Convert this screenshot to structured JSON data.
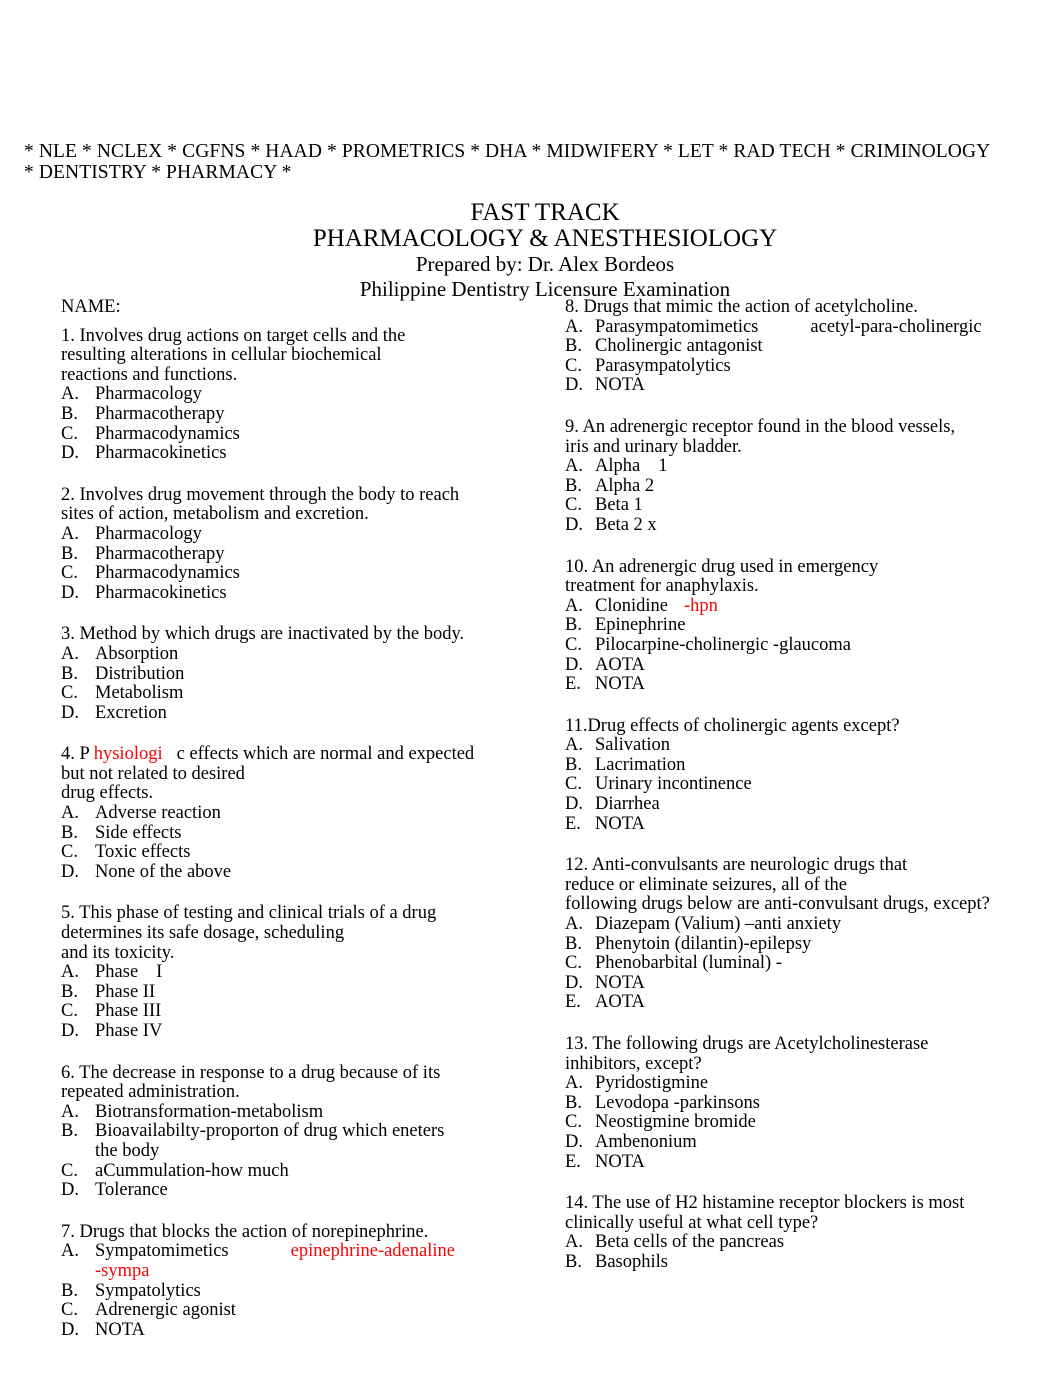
{
  "document": {
    "masthead": "* NLE * NCLEX * CGFNS * HAAD * PROMETRICS * DHA * MIDWIFERY * LET * RAD TECH * CRIMINOLOGY * DENTISTRY * PHARMACY *",
    "title_main": "FAST TRACK",
    "title_subject": "PHARMACOLOGY & ANESTHESIOLOGY",
    "prepared_by": "Prepared by: Dr. Alex Bordeos",
    "exam_name": "Philippine Dentistry Licensure Examination",
    "name_field_label": "NAME:",
    "accent_red": "#fa0505",
    "text_color": "#000000",
    "background": "#ffffff"
  },
  "left_column": {
    "questions": [
      {
        "number": "1.",
        "stem_lines": [
          "1. Involves drug actions on target cells and the",
          "resulting alterations in cellular biochemical",
          "reactions and functions."
        ],
        "options": [
          {
            "letter": "A.",
            "text": "Pharmacology"
          },
          {
            "letter": "B.",
            "text": "Pharmacotherapy"
          },
          {
            "letter": "C.",
            "text": "Pharmacodynamics"
          },
          {
            "letter": "D.",
            "text": "Pharmacokinetics"
          }
        ]
      },
      {
        "number": "2.",
        "stem_lines": [
          "2. Involves drug movement through the body to reach",
          "sites of action, metabolism and excretion."
        ],
        "options": [
          {
            "letter": "A.",
            "text": "Pharmacology"
          },
          {
            "letter": "B.",
            "text": "Pharmacotherapy"
          },
          {
            "letter": "C.",
            "text": "Pharmacodynamics"
          },
          {
            "letter": "D.",
            "text": "Pharmacokinetics"
          }
        ]
      },
      {
        "number": "3.",
        "stem_lines": [
          "3. Method by which drugs are inactivated by the body."
        ],
        "options": [
          {
            "letter": "A.",
            "text": "Absorption"
          },
          {
            "letter": "B.",
            "text": "Distribution"
          },
          {
            "letter": "C.",
            "text": "Metabolism"
          },
          {
            "letter": "D.",
            "text": "Excretion"
          }
        ]
      },
      {
        "number": "4.",
        "stem_part_1": "4. P",
        "stem_red": "hysiologi",
        "stem_part_2": "c effects which are normal and expected",
        "stem_lines_rest": [
          "but not related to desired",
          "drug effects."
        ],
        "options": [
          {
            "letter": "A.",
            "text": "Adverse reaction"
          },
          {
            "letter": "B.",
            "text": "Side effects"
          },
          {
            "letter": "C.",
            "text": "Toxic effects"
          },
          {
            "letter": "D.",
            "text": "None of the above"
          }
        ]
      },
      {
        "number": "5.",
        "stem_lines": [
          "5. This phase of testing and clinical trials of a drug",
          "determines its safe dosage, scheduling",
          "and its toxicity."
        ],
        "options": [
          {
            "letter": "A.",
            "text": "Phase",
            "extra": "I"
          },
          {
            "letter": "B.",
            "text": "Phase II"
          },
          {
            "letter": "C.",
            "text": "Phase III"
          },
          {
            "letter": "D.",
            "text": "Phase IV"
          }
        ]
      },
      {
        "number": "6.",
        "stem_lines": [
          "6. The decrease in response to a drug because of its",
          "repeated administration."
        ],
        "options": [
          {
            "letter": "A.",
            "text": "Biotransformation-metabolism"
          },
          {
            "letter": "B.",
            "text": "Bioavailabilty-proporton of drug which eneters",
            "text_line2": "the body"
          },
          {
            "letter": "C.",
            "text": "aCummulation-how much"
          },
          {
            "letter": "D.",
            "text": "Tolerance"
          }
        ]
      },
      {
        "number": "7.",
        "stem_lines": [
          "7. Drugs that blocks the action of norepinephrine."
        ],
        "options": [
          {
            "letter": "A.",
            "text": "Sympatomimetics",
            "annotation_red": "epinephrine-adenaline",
            "annotation_red_line2": "-sympa"
          },
          {
            "letter": "B.",
            "text": "Sympatolytics"
          },
          {
            "letter": "C.",
            "text": "Adrenergic agonist"
          },
          {
            "letter": "D.",
            "text": "NOTA"
          }
        ]
      }
    ]
  },
  "right_column": {
    "questions": [
      {
        "number": "8.",
        "stem_lines": [
          "8. Drugs that mimic the action of acetylcholine."
        ],
        "options": [
          {
            "letter": "A.",
            "text": "Parasympatomimetics",
            "annotation": "acetyl-para-cholinergic"
          },
          {
            "letter": "B.",
            "text": "Cholinergic antagonist"
          },
          {
            "letter": "C.",
            "text": "Parasympatolytics"
          },
          {
            "letter": "D.",
            "text": "NOTA"
          }
        ]
      },
      {
        "number": "9.",
        "stem_lines": [
          "9. An adrenergic receptor found in the blood vessels,",
          "iris and urinary bladder."
        ],
        "options": [
          {
            "letter": "A.",
            "text": "Alpha",
            "extra": "1"
          },
          {
            "letter": "B.",
            "text": "Alpha 2"
          },
          {
            "letter": "C.",
            "text": "Beta 1"
          },
          {
            "letter": "D.",
            "text": "Beta 2 x"
          }
        ]
      },
      {
        "number": "10.",
        "stem_lines": [
          "10. An adrenergic drug used in emergency",
          "treatment for anaphylaxis."
        ],
        "options": [
          {
            "letter": "A.",
            "text": "Clonidine",
            "annotation_red": "-hpn"
          },
          {
            "letter": "B.",
            "text": "Epinephrine"
          },
          {
            "letter": "C.",
            "text": "Pilocarpine-cholinergic -glaucoma"
          },
          {
            "letter": "D.",
            "text": "AOTA"
          },
          {
            "letter": "E.",
            "text": "NOTA"
          }
        ]
      },
      {
        "number": "11.",
        "stem_lines": [
          "11.Drug effects of cholinergic agents except?"
        ],
        "options": [
          {
            "letter": "A.",
            "text": "Salivation"
          },
          {
            "letter": "B.",
            "text": "Lacrimation"
          },
          {
            "letter": "C.",
            "text": "Urinary incontinence"
          },
          {
            "letter": "D.",
            "text": "Diarrhea"
          },
          {
            "letter": "E.",
            "text": "NOTA"
          }
        ]
      },
      {
        "number": "12.",
        "stem_lines": [
          "12. Anti-convulsants are neurologic drugs that",
          "reduce or eliminate seizures, all of the",
          "following drugs below are anti-convulsant drugs, except?"
        ],
        "options": [
          {
            "letter": "A.",
            "text": "Diazepam (Valium) –anti anxiety"
          },
          {
            "letter": "B.",
            "text": "Phenytoin (dilantin)-epilepsy"
          },
          {
            "letter": "C.",
            "text": "Phenobarbital (luminal) -"
          },
          {
            "letter": "D.",
            "text": "NOTA"
          },
          {
            "letter": "E.",
            "text": "AOTA"
          }
        ]
      },
      {
        "number": "13.",
        "stem_lines": [
          "13. The following drugs are Acetylcholinesterase",
          "inhibitors, except?"
        ],
        "options": [
          {
            "letter": "A.",
            "text": "Pyridostigmine"
          },
          {
            "letter": "B.",
            "text": "Levodopa -parkinsons"
          },
          {
            "letter": "C.",
            "text": "Neostigmine bromide"
          },
          {
            "letter": "D.",
            "text": "Ambenonium"
          },
          {
            "letter": "E.",
            "text": "NOTA"
          }
        ]
      },
      {
        "number": "14.",
        "stem_lines": [
          "14. The use of H2 histamine receptor blockers is most",
          "clinically useful at what cell type?"
        ],
        "options": [
          {
            "letter": "A.",
            "text": "Beta cells of the pancreas"
          },
          {
            "letter": "B.",
            "text": "Basophils"
          }
        ]
      }
    ]
  }
}
